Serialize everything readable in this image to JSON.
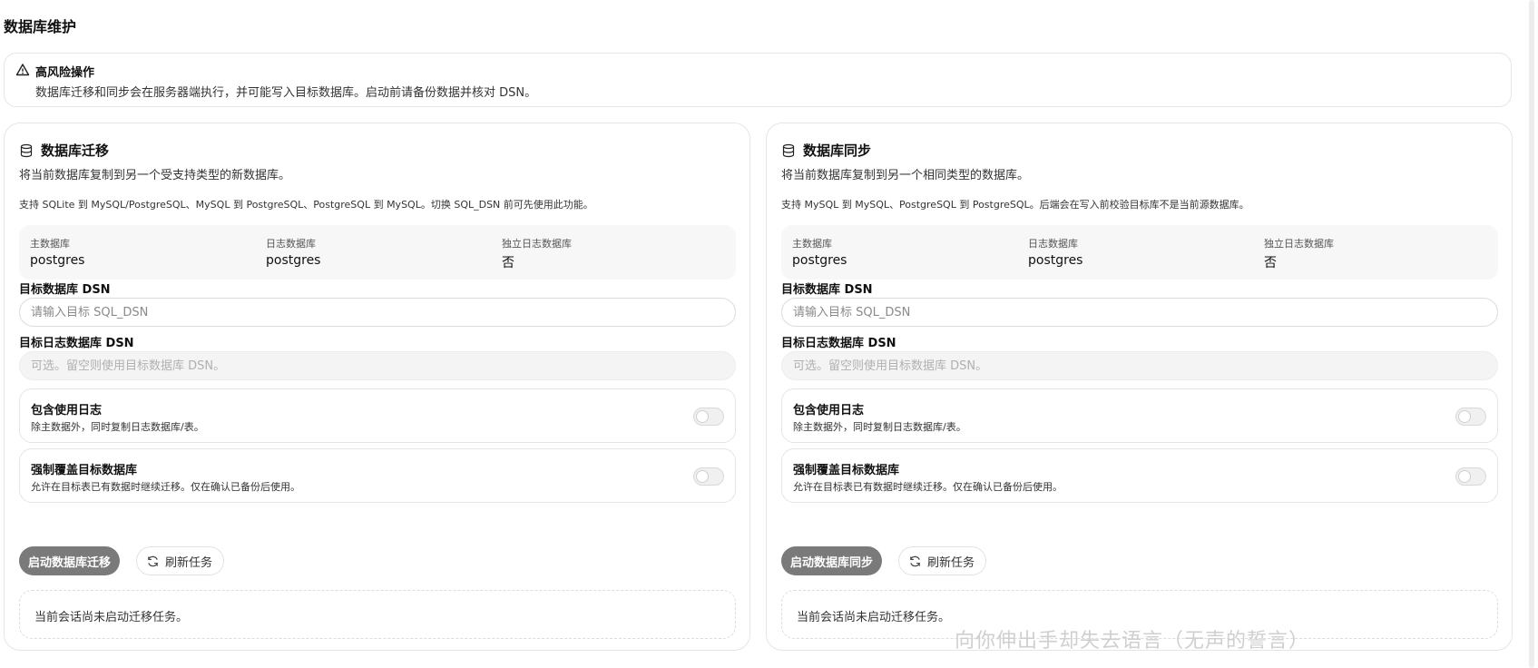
{
  "page": {
    "title": "数据库维护"
  },
  "alert": {
    "icon": "warning-triangle-icon",
    "title": "高风险操作",
    "description": "数据库迁移和同步会在服务器端执行，并可能写入目标数据库。启动前请备份数据并核对 DSN。"
  },
  "migration": {
    "icon": "database-icon",
    "title": "数据库迁移",
    "description": "将当前数据库复制到另一个受支持类型的新数据库。",
    "note": "支持 SQLite 到 MySQL/PostgreSQL、MySQL 到 PostgreSQL、PostgreSQL 到 MySQL。切换 SQL_DSN 前可先使用此功能。",
    "info": [
      {
        "label": "主数据库",
        "value": "postgres"
      },
      {
        "label": "日志数据库",
        "value": "postgres"
      },
      {
        "label": "独立日志数据库",
        "value": "否"
      }
    ],
    "target_dsn_label": "目标数据库 DSN",
    "target_dsn_placeholder": "请输入目标 SQL_DSN",
    "target_dsn_value": "",
    "target_log_dsn_label": "目标日志数据库 DSN",
    "target_log_dsn_placeholder": "可选。留空则使用目标数据库 DSN。",
    "target_log_dsn_value": "",
    "option_logs": {
      "title": "包含使用日志",
      "description": "除主数据外，同时复制日志数据库/表。",
      "enabled": false
    },
    "option_force": {
      "title": "强制覆盖目标数据库",
      "description": "允许在目标表已有数据时继续迁移。仅在确认已备份后使用。",
      "enabled": false
    },
    "start_button": "启动数据库迁移",
    "refresh_button": "刷新任务",
    "status": "当前会话尚未启动迁移任务。"
  },
  "sync": {
    "icon": "database-icon",
    "title": "数据库同步",
    "description": "将当前数据库复制到另一个相同类型的数据库。",
    "note": "支持 MySQL 到 MySQL、PostgreSQL 到 PostgreSQL。后端会在写入前校验目标库不是当前源数据库。",
    "info": [
      {
        "label": "主数据库",
        "value": "postgres"
      },
      {
        "label": "日志数据库",
        "value": "postgres"
      },
      {
        "label": "独立日志数据库",
        "value": "否"
      }
    ],
    "target_dsn_label": "目标数据库 DSN",
    "target_dsn_placeholder": "请输入目标 SQL_DSN",
    "target_dsn_value": "",
    "target_log_dsn_label": "目标日志数据库 DSN",
    "target_log_dsn_placeholder": "可选。留空则使用目标数据库 DSN。",
    "target_log_dsn_value": "",
    "option_logs": {
      "title": "包含使用日志",
      "description": "除主数据外，同时复制日志数据库/表。",
      "enabled": false
    },
    "option_force": {
      "title": "强制覆盖目标数据库",
      "description": "允许在目标表已有数据时继续迁移。仅在确认已备份后使用。",
      "enabled": false
    },
    "start_button": "启动数据库同步",
    "refresh_button": "刷新任务",
    "status": "当前会话尚未启动迁移任务。"
  },
  "overlay": {
    "line1": "向你伸出手却失去语言（无声的誓言）"
  }
}
